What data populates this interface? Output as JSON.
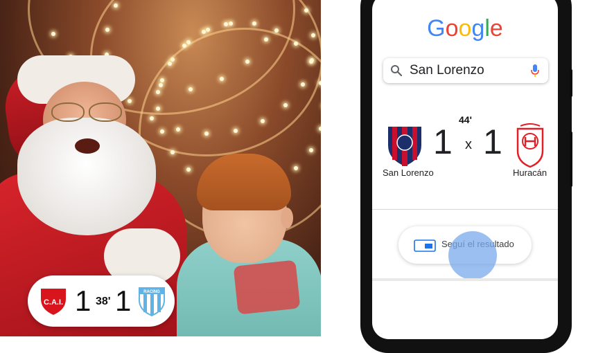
{
  "scene": {
    "score_pill": {
      "home_crest": "independiente-crest",
      "home_crest_text": "C.A.I.",
      "home_score": "1",
      "minute": "38'",
      "away_score": "1",
      "away_crest": "racing-crest",
      "away_crest_text": "RACING"
    }
  },
  "phone": {
    "logo": [
      "G",
      "o",
      "o",
      "g",
      "l",
      "e"
    ],
    "logo_colors": [
      "#4285F4",
      "#EA4335",
      "#FBBC05",
      "#4285F4",
      "#34A853",
      "#EA4335"
    ],
    "search": {
      "value": "San Lorenzo",
      "left_icon": "search-icon",
      "right_icon": "mic-icon"
    },
    "match": {
      "minute": "44'",
      "home_team": "San Lorenzo",
      "home_crest": "san-lorenzo-crest",
      "home_score": "1",
      "separator": "x",
      "away_score": "1",
      "away_team": "Huracán",
      "away_crest": "huracan-crest"
    },
    "follow_button": {
      "label": "Seguí el resultado",
      "icon": "card-icon"
    }
  }
}
